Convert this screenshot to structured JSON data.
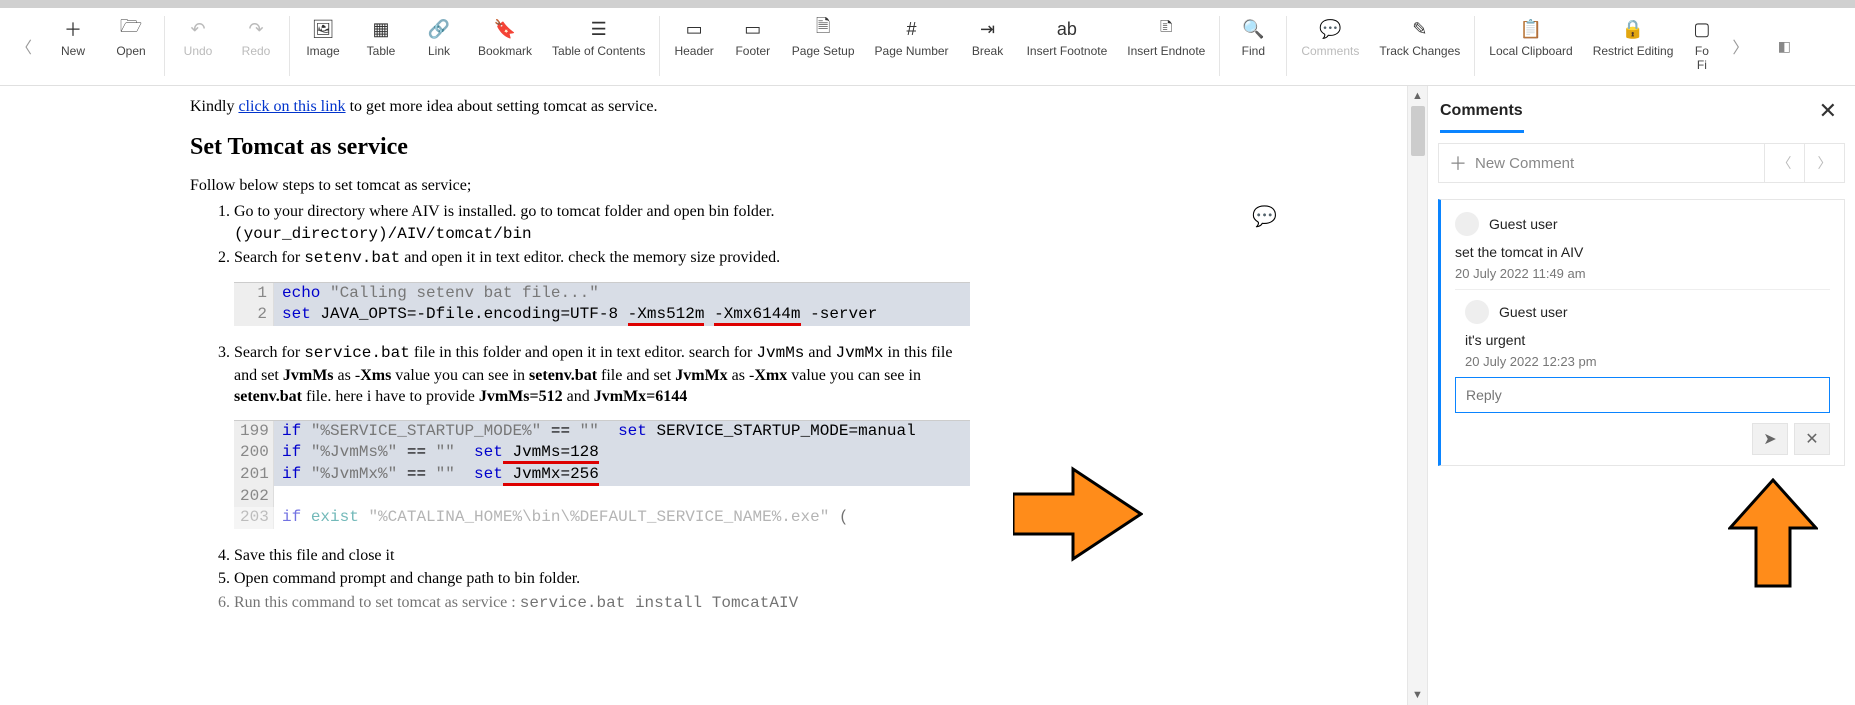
{
  "toolbar": {
    "new": "New",
    "open": "Open",
    "undo": "Undo",
    "redo": "Redo",
    "image": "Image",
    "table": "Table",
    "link": "Link",
    "bookmark": "Bookmark",
    "toc": "Table of Contents",
    "header": "Header",
    "footer": "Footer",
    "pageSetup": "Page Setup",
    "pageNumber": "Page Number",
    "break": "Break",
    "footnote": "Insert Footnote",
    "endnote": "Insert Endnote",
    "find": "Find",
    "comments": "Comments",
    "trackChanges": "Track Changes",
    "localClipboard": "Local Clipboard",
    "restrictEditing": "Restrict Editing",
    "formFields": "Fo\nFi"
  },
  "doc": {
    "intro_pre": "Kindly ",
    "intro_link": "click on this link",
    "intro_post": " to get more idea about setting tomcat as service.",
    "heading": "Set Tomcat as service",
    "follow": "Follow below steps to set tomcat as service;",
    "li1": "Go to your directory where AIV is installed. go to tomcat folder and open bin folder.",
    "li1_path": "(your_directory)/AIV/tomcat/bin",
    "li2_a": "Search for ",
    "li2_file": "setenv.bat",
    "li2_b": " and open it in text editor. check the memory size provided.",
    "code1": {
      "ln1": "1",
      "ln2": "2",
      "c1_kw": "echo",
      "c1_str": "\"Calling setenv bat file...\"",
      "c2_kw": "set",
      "c2_rest1": " JAVA_OPTS=-Dfile.encoding=UTF-8 ",
      "c2_xms": "-Xms512m",
      "c2_sp": " ",
      "c2_xmx": "-Xmx6144m",
      "c2_rest2": " -server"
    },
    "li3_a": "Search for ",
    "li3_file": "service.bat",
    "li3_b": " file in this folder and open it in text editor. search for ",
    "li3_jvmms": "JvmMs",
    "li3_c": " and ",
    "li3_jvmmx": "JvmMx",
    "li3_d": " in this file and set ",
    "li3_e": " as -",
    "li3_xms": "Xms",
    "li3_f": " value you can see in ",
    "li3_setenv": "setenv.bat",
    "li3_g": " file and set ",
    "li3_h": " as -",
    "li3_xmx": "Xmx",
    "li3_i": " value you can see in ",
    "li3_j": " file. here i have to provide ",
    "li3_k": "JvmMs=512",
    "li3_l": " and ",
    "li3_m": "JvmMx=6144",
    "code2": {
      "ln199": "199",
      "ln200": "200",
      "ln201": "201",
      "ln202": "202",
      "ln203": "203",
      "r1_if": "if ",
      "r1_q": "\"%SERVICE_STARTUP_MODE%\"",
      "r1_eq": " == ",
      "r1_emp": "\"\"",
      "r1_set": "  set",
      "r1_rest": " SERVICE_STARTUP_MODE=manual",
      "r2_if": "if ",
      "r2_q": "\"%JvmMs%\"",
      "r2_eq": " == ",
      "r2_emp": "\"\"",
      "r2_set": "  set",
      "r2_rest": " JvmMs=128",
      "r3_if": "if ",
      "r3_q": "\"%JvmMx%\"",
      "r3_eq": " == ",
      "r3_emp": "\"\"",
      "r3_set": "  set",
      "r3_rest": " JvmMx=256",
      "r5": "if exist \"%CATALINA_HOME%\\bin\\%DEFAULT_SERVICE_NAME%.exe\" ("
    },
    "li4": "Save this file and close it",
    "li5": "Open command prompt and change path to bin folder.",
    "li6_a": "Run this command to set tomcat as service : ",
    "li6_cmd": "service.bat install TomcatAIV"
  },
  "panel": {
    "title": "Comments",
    "newComment": "New Comment",
    "thread": {
      "user1": "Guest user",
      "text1": "set the tomcat in AIV",
      "time1": "20 July 2022 11:49 am",
      "user2": "Guest user",
      "text2": "it's urgent",
      "time2": "20 July 2022 12:23 pm",
      "replyPlaceholder": "Reply"
    }
  }
}
